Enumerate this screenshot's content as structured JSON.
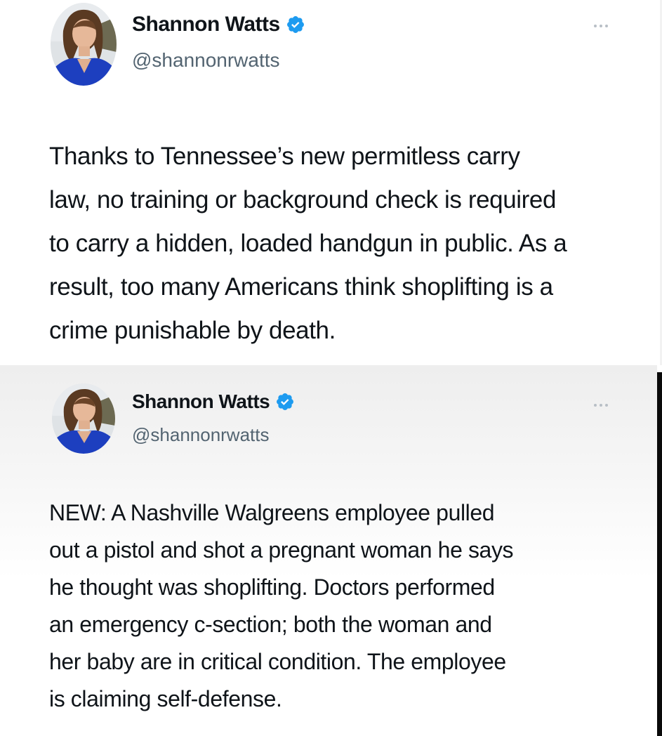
{
  "tweets": [
    {
      "author": {
        "display_name": "Shannon Watts",
        "handle": "@shannonrwatts",
        "verified": true
      },
      "more_icon": "more-horizontal-icon",
      "text": "Thanks to Tennessee’s new permitless carry\nlaw, no training or background check is required\nto carry a hidden, loaded handgun in public. As a\nresult, too many Americans think shoplifting is a\ncrime punishable by death."
    },
    {
      "author": {
        "display_name": "Shannon Watts",
        "handle": "@shannonrwatts",
        "verified": true
      },
      "more_icon": "more-horizontal-icon",
      "text": "NEW: A Nashville Walgreens employee pulled\nout a pistol and shot a pregnant woman he says\nhe thought was shoplifting. Doctors performed\nan emergency c-section; both the woman and\nher baby are in critical condition. The employee\nis claiming self-defense."
    }
  ],
  "colors": {
    "verified_badge": "#1d9bf0",
    "text_primary": "#0f1419",
    "text_secondary": "#536471"
  }
}
